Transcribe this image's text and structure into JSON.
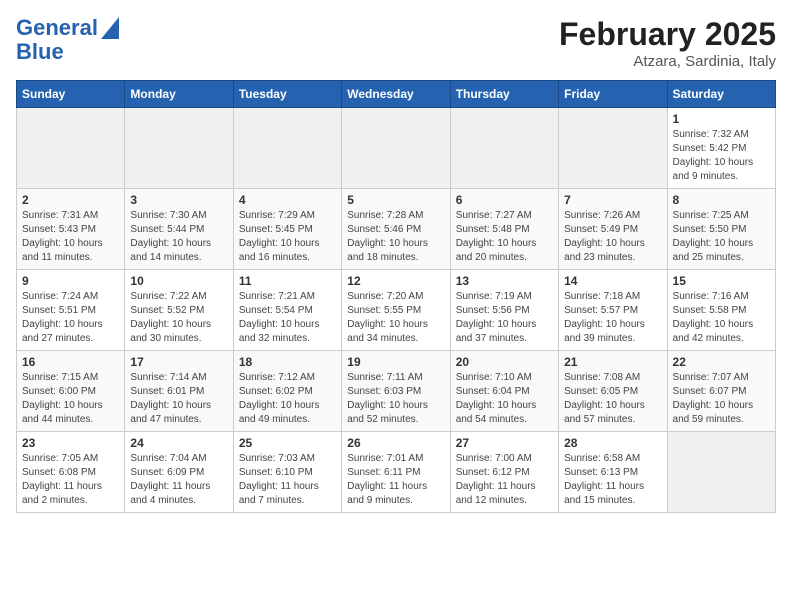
{
  "logo": {
    "line1": "General",
    "line2": "Blue"
  },
  "title": "February 2025",
  "subtitle": "Atzara, Sardinia, Italy",
  "days_of_week": [
    "Sunday",
    "Monday",
    "Tuesday",
    "Wednesday",
    "Thursday",
    "Friday",
    "Saturday"
  ],
  "weeks": [
    [
      {
        "day": "",
        "info": ""
      },
      {
        "day": "",
        "info": ""
      },
      {
        "day": "",
        "info": ""
      },
      {
        "day": "",
        "info": ""
      },
      {
        "day": "",
        "info": ""
      },
      {
        "day": "",
        "info": ""
      },
      {
        "day": "1",
        "info": "Sunrise: 7:32 AM\nSunset: 5:42 PM\nDaylight: 10 hours and 9 minutes."
      }
    ],
    [
      {
        "day": "2",
        "info": "Sunrise: 7:31 AM\nSunset: 5:43 PM\nDaylight: 10 hours and 11 minutes."
      },
      {
        "day": "3",
        "info": "Sunrise: 7:30 AM\nSunset: 5:44 PM\nDaylight: 10 hours and 14 minutes."
      },
      {
        "day": "4",
        "info": "Sunrise: 7:29 AM\nSunset: 5:45 PM\nDaylight: 10 hours and 16 minutes."
      },
      {
        "day": "5",
        "info": "Sunrise: 7:28 AM\nSunset: 5:46 PM\nDaylight: 10 hours and 18 minutes."
      },
      {
        "day": "6",
        "info": "Sunrise: 7:27 AM\nSunset: 5:48 PM\nDaylight: 10 hours and 20 minutes."
      },
      {
        "day": "7",
        "info": "Sunrise: 7:26 AM\nSunset: 5:49 PM\nDaylight: 10 hours and 23 minutes."
      },
      {
        "day": "8",
        "info": "Sunrise: 7:25 AM\nSunset: 5:50 PM\nDaylight: 10 hours and 25 minutes."
      }
    ],
    [
      {
        "day": "9",
        "info": "Sunrise: 7:24 AM\nSunset: 5:51 PM\nDaylight: 10 hours and 27 minutes."
      },
      {
        "day": "10",
        "info": "Sunrise: 7:22 AM\nSunset: 5:52 PM\nDaylight: 10 hours and 30 minutes."
      },
      {
        "day": "11",
        "info": "Sunrise: 7:21 AM\nSunset: 5:54 PM\nDaylight: 10 hours and 32 minutes."
      },
      {
        "day": "12",
        "info": "Sunrise: 7:20 AM\nSunset: 5:55 PM\nDaylight: 10 hours and 34 minutes."
      },
      {
        "day": "13",
        "info": "Sunrise: 7:19 AM\nSunset: 5:56 PM\nDaylight: 10 hours and 37 minutes."
      },
      {
        "day": "14",
        "info": "Sunrise: 7:18 AM\nSunset: 5:57 PM\nDaylight: 10 hours and 39 minutes."
      },
      {
        "day": "15",
        "info": "Sunrise: 7:16 AM\nSunset: 5:58 PM\nDaylight: 10 hours and 42 minutes."
      }
    ],
    [
      {
        "day": "16",
        "info": "Sunrise: 7:15 AM\nSunset: 6:00 PM\nDaylight: 10 hours and 44 minutes."
      },
      {
        "day": "17",
        "info": "Sunrise: 7:14 AM\nSunset: 6:01 PM\nDaylight: 10 hours and 47 minutes."
      },
      {
        "day": "18",
        "info": "Sunrise: 7:12 AM\nSunset: 6:02 PM\nDaylight: 10 hours and 49 minutes."
      },
      {
        "day": "19",
        "info": "Sunrise: 7:11 AM\nSunset: 6:03 PM\nDaylight: 10 hours and 52 minutes."
      },
      {
        "day": "20",
        "info": "Sunrise: 7:10 AM\nSunset: 6:04 PM\nDaylight: 10 hours and 54 minutes."
      },
      {
        "day": "21",
        "info": "Sunrise: 7:08 AM\nSunset: 6:05 PM\nDaylight: 10 hours and 57 minutes."
      },
      {
        "day": "22",
        "info": "Sunrise: 7:07 AM\nSunset: 6:07 PM\nDaylight: 10 hours and 59 minutes."
      }
    ],
    [
      {
        "day": "23",
        "info": "Sunrise: 7:05 AM\nSunset: 6:08 PM\nDaylight: 11 hours and 2 minutes."
      },
      {
        "day": "24",
        "info": "Sunrise: 7:04 AM\nSunset: 6:09 PM\nDaylight: 11 hours and 4 minutes."
      },
      {
        "day": "25",
        "info": "Sunrise: 7:03 AM\nSunset: 6:10 PM\nDaylight: 11 hours and 7 minutes."
      },
      {
        "day": "26",
        "info": "Sunrise: 7:01 AM\nSunset: 6:11 PM\nDaylight: 11 hours and 9 minutes."
      },
      {
        "day": "27",
        "info": "Sunrise: 7:00 AM\nSunset: 6:12 PM\nDaylight: 11 hours and 12 minutes."
      },
      {
        "day": "28",
        "info": "Sunrise: 6:58 AM\nSunset: 6:13 PM\nDaylight: 11 hours and 15 minutes."
      },
      {
        "day": "",
        "info": ""
      }
    ]
  ]
}
